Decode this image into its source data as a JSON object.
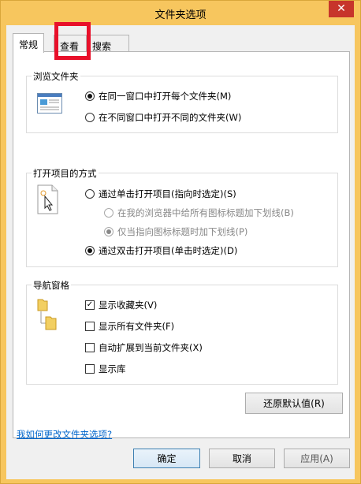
{
  "window": {
    "title": "文件夹选项",
    "close_glyph": "✕"
  },
  "tabs": [
    {
      "label": "常规",
      "active": true
    },
    {
      "label": "查看",
      "active": false
    },
    {
      "label": "搜索",
      "active": false
    }
  ],
  "browse": {
    "title": "浏览文件夹",
    "option_same": "在同一窗口中打开每个文件夹(M)",
    "option_new": "在不同窗口中打开不同的文件夹(W)",
    "selected": "option_same"
  },
  "click": {
    "title": "打开项目的方式",
    "single": "通过单击打开项目(指向时选定)(S)",
    "underline_all": "在我的浏览器中给所有图标标题加下划线(B)",
    "underline_point": "仅当指向图标标题时加下划线(P)",
    "double": "通过双击打开项目(单击时选定)(D)",
    "selected": "double"
  },
  "nav": {
    "title": "导航窗格",
    "show_favorites": {
      "label": "显示收藏夹(V)",
      "checked": true
    },
    "show_all": {
      "label": "显示所有文件夹(F)",
      "checked": false
    },
    "auto_expand": {
      "label": "自动扩展到当前文件夹(X)",
      "checked": false
    },
    "show_libraries": {
      "label": "显示库",
      "checked": false
    }
  },
  "restore_button": "还原默认值(R)",
  "help_link": "我如何更改文件夹选项?",
  "footer": {
    "ok": "确定",
    "cancel": "取消",
    "apply": "应用(A)"
  },
  "colors": {
    "title_bar": "#f7c65e",
    "highlight": "#e8102a",
    "link": "#0066cc"
  }
}
